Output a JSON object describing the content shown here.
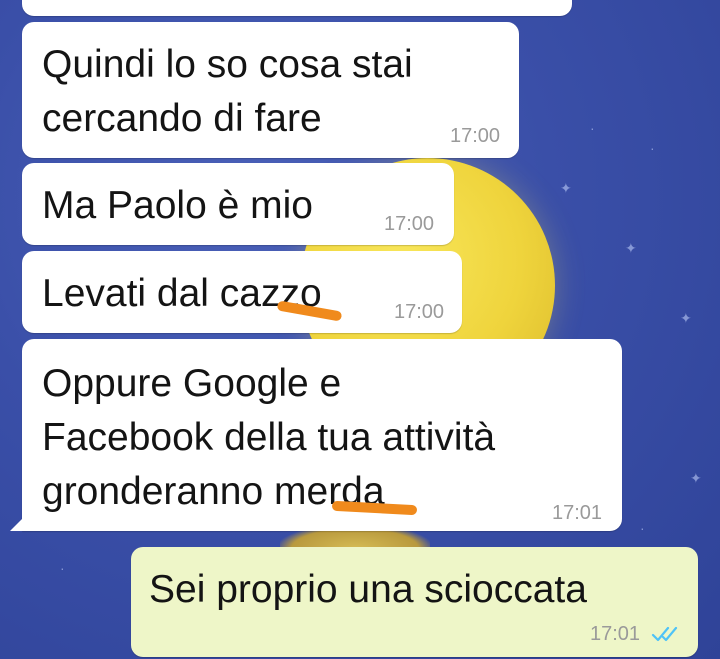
{
  "colors": {
    "wallpaper": "#3a4fa8",
    "incoming_bubble": "#ffffff",
    "outgoing_bubble": "#eef6c8",
    "read_ticks": "#4fc3f7",
    "redaction_mark": "#f08a1c"
  },
  "messages": [
    {
      "direction": "in",
      "text": "Quindi lo so cosa stai\ncercando di fare",
      "time": "17:00"
    },
    {
      "direction": "in",
      "text": "Ma Paolo è mio",
      "time": "17:00"
    },
    {
      "direction": "in",
      "text": "Levati dal cazzo",
      "time": "17:00"
    },
    {
      "direction": "in",
      "text": "Oppure Google e\nFacebook della tua attività\ngronderanno merda",
      "time": "17:01"
    },
    {
      "direction": "out",
      "text": "Sei proprio una scioccata",
      "time": "17:01",
      "status": "read",
      "status_icon": "double-check-icon"
    }
  ]
}
